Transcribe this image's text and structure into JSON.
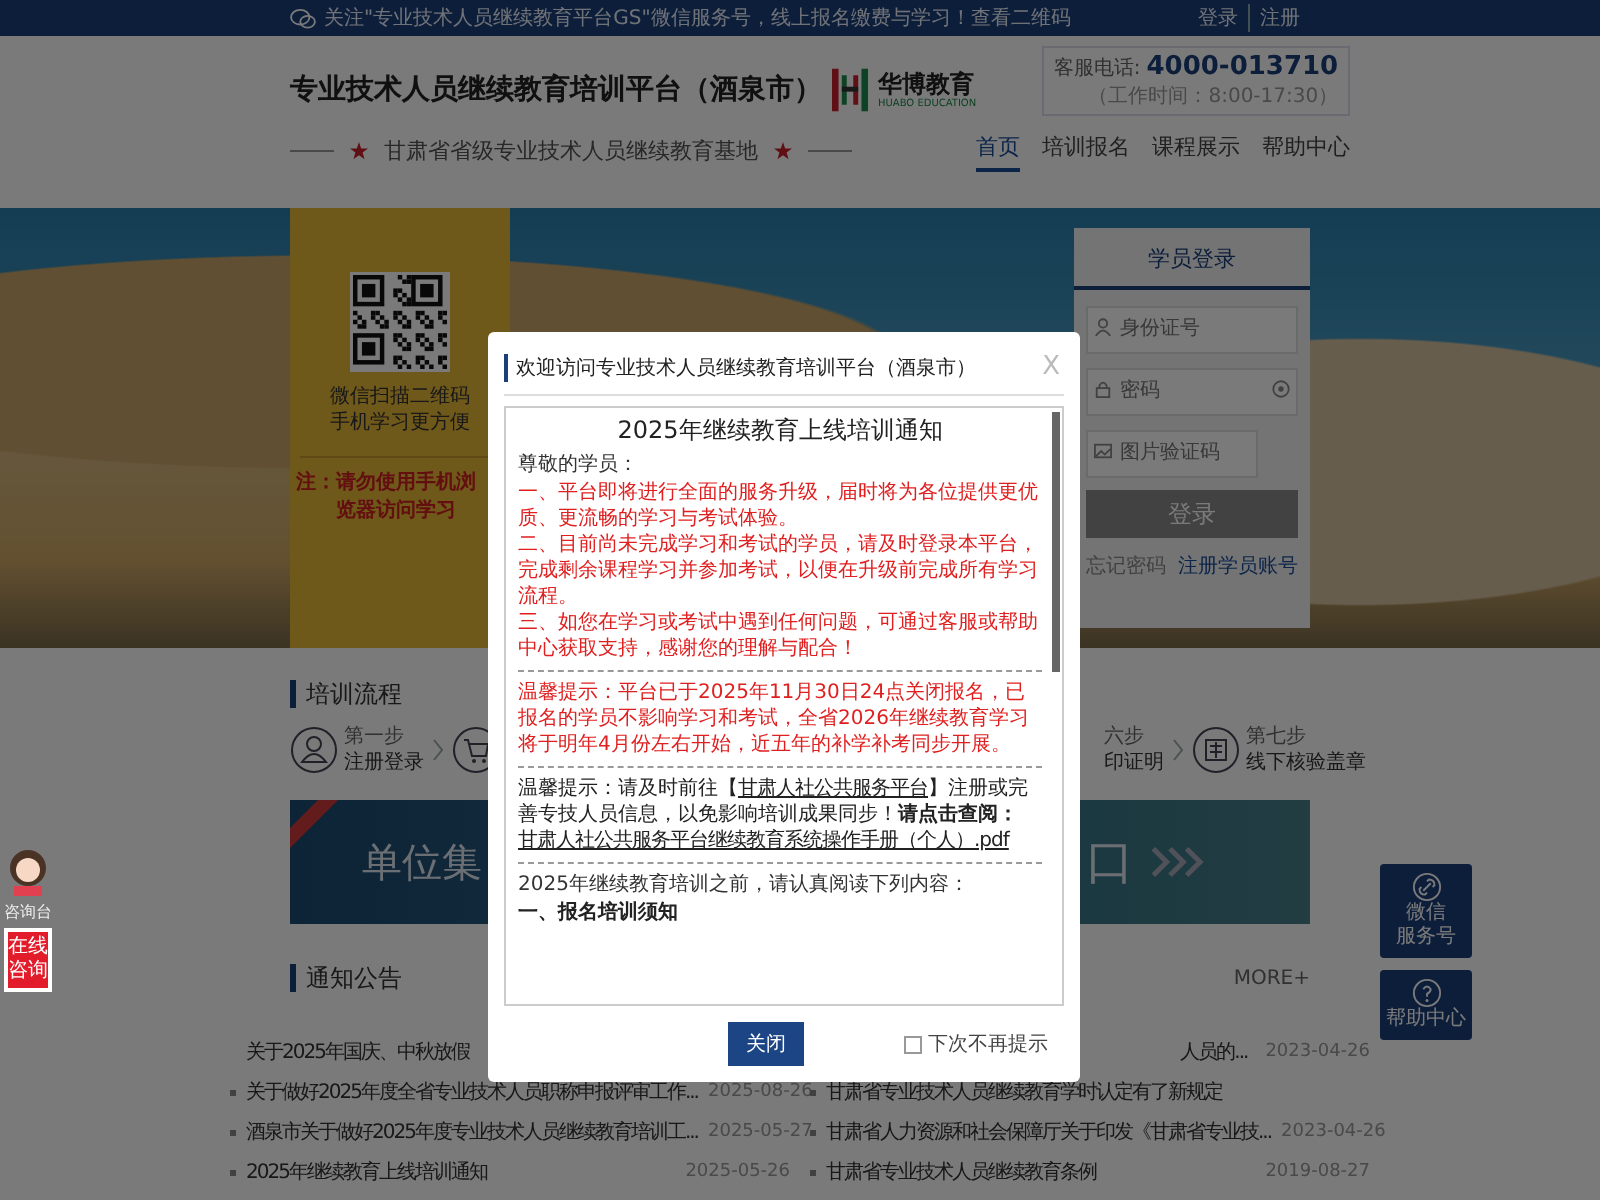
{
  "top_bar": {
    "notice": "关注\"专业技术人员继续教育平台GS\"微信服务号，线上报名缴费与学习！查看二维码",
    "links": [
      "登录",
      "注册"
    ]
  },
  "header": {
    "title": "专业技术人员继续教育培训平台（酒泉市）",
    "logo_name": "华博教育",
    "logo_sub": "HUABO EDUCATION",
    "phone_label": "客服电话:",
    "phone": "4000-013710",
    "hours": "（工作时间：8:00-17:30）",
    "subtitle": "甘肃省省级专业技术人员继续教育基地"
  },
  "nav": [
    {
      "label": "首页",
      "selected": true
    },
    {
      "label": "培训报名",
      "selected": false
    },
    {
      "label": "课程展示",
      "selected": false
    },
    {
      "label": "帮助中心",
      "selected": false
    }
  ],
  "qr_panel": {
    "caption": [
      "微信扫描二维码",
      "手机学习更方便"
    ],
    "note": "注：请勿使用手机浏览器访问学习"
  },
  "login": {
    "tab": "学员登录",
    "fields": [
      {
        "kind": "user",
        "placeholder": "身份证号"
      },
      {
        "kind": "password",
        "placeholder": "密码"
      },
      {
        "kind": "captcha",
        "placeholder": "图片验证码"
      }
    ],
    "button": "登录",
    "forgot": "忘记密码",
    "register": "注册学员账号"
  },
  "training_flow": {
    "title": "培训流程",
    "steps": [
      {
        "kind": "full",
        "step": "第一步",
        "label": "注册登录"
      },
      {
        "kind": "icon-only"
      },
      {
        "kind": "text-only",
        "step": "六步",
        "label": "印证明"
      },
      {
        "kind": "full",
        "step": "第七步",
        "label": "线下核验盖章"
      }
    ]
  },
  "ad_banner": {
    "title": "单位集",
    "tail": "口"
  },
  "notices": {
    "title": "通知公告",
    "more": "MORE+",
    "rows": [
      {
        "left": {
          "kind": "partial",
          "text": "关于2025年国庆、中秋放假"
        },
        "right": {
          "kind": "partial",
          "text": "人员的...",
          "date": "2023-04-26"
        }
      },
      {
        "left": {
          "kind": "full",
          "text": "关于做好2025年度全省专业技术人员职称申报评审工作...",
          "date": "2025-08-26"
        },
        "right": {
          "kind": "full",
          "text": "甘肃省专业技术人员继续教育学时认定有了新规定"
        }
      },
      {
        "left": {
          "kind": "full",
          "text": "酒泉市关于做好2025年度专业技术人员继续教育培训工...",
          "date": "2025-05-27"
        },
        "right": {
          "kind": "full",
          "text": "甘肃省人力资源和社会保障厅关于印发《甘肃省专业技...",
          "date": "2023-04-26"
        }
      },
      {
        "left": {
          "kind": "full",
          "text": "2025年继续教育上线培训通知",
          "date": "2025-05-26"
        },
        "right": {
          "kind": "full",
          "text": "甘肃省专业技术人员继续教育条例",
          "date": "2019-08-27"
        }
      }
    ]
  },
  "float_left": {
    "caption": "咨询台",
    "button": "在线咨询"
  },
  "float_right": [
    {
      "kind": "link",
      "lines": [
        "微信",
        "服务号"
      ]
    },
    {
      "kind": "help",
      "lines": [
        "帮助中心"
      ]
    }
  ],
  "modal": {
    "title": "欢迎访问专业技术人员继续教育培训平台（酒泉市）",
    "close": "X",
    "blocks": [
      {
        "kind": "heading",
        "text": "2025年继续教育上线培训通知"
      },
      {
        "kind": "text",
        "text": "尊敬的学员："
      },
      {
        "kind": "alert",
        "text": "一、平台即将进行全面的服务升级，届时将为各位提供更优质、更流畅的学习与考试体验。"
      },
      {
        "kind": "alert",
        "text": "二、目前尚未完成学习和考试的学员，请及时登录本平台，完成剩余课程学习并参加考试，以便在升级前完成所有学习流程。"
      },
      {
        "kind": "alert",
        "text": "三、如您在学习或考试中遇到任何问题，可通过客服或帮助中心获取支持，感谢您的理解与配合！"
      },
      {
        "kind": "rule"
      },
      {
        "kind": "alert",
        "text": "温馨提示：平台已于2025年11月30日24点关闭报名，已报名的学员不影响学习和考试，全省2026年继续教育学习将于明年4月份左右开始，近五年的补学补考同步开展。"
      },
      {
        "kind": "rule"
      },
      {
        "kind": "rich",
        "parts": [
          {
            "kind": "text",
            "text": "温馨提示：请及时前往【"
          },
          {
            "kind": "link",
            "text": "甘肃人社公共服务平台"
          },
          {
            "kind": "text",
            "text": "】注册或完善专技人员信息，以免影响培训成果同步！**请点击查阅：**"
          },
          {
            "kind": "link",
            "text": "甘肃人社公共服务平台继续教育系统操作手册（个人）.pdf"
          }
        ]
      },
      {
        "kind": "rule"
      },
      {
        "kind": "text",
        "text": "2025年继续教育培训之前，请认真阅读下列内容："
      },
      {
        "kind": "subheading",
        "text": "一、报名培训须知"
      }
    ],
    "close_button": "关闭",
    "dont_show": {
      "label": "下次不再提示",
      "checked": false
    }
  }
}
